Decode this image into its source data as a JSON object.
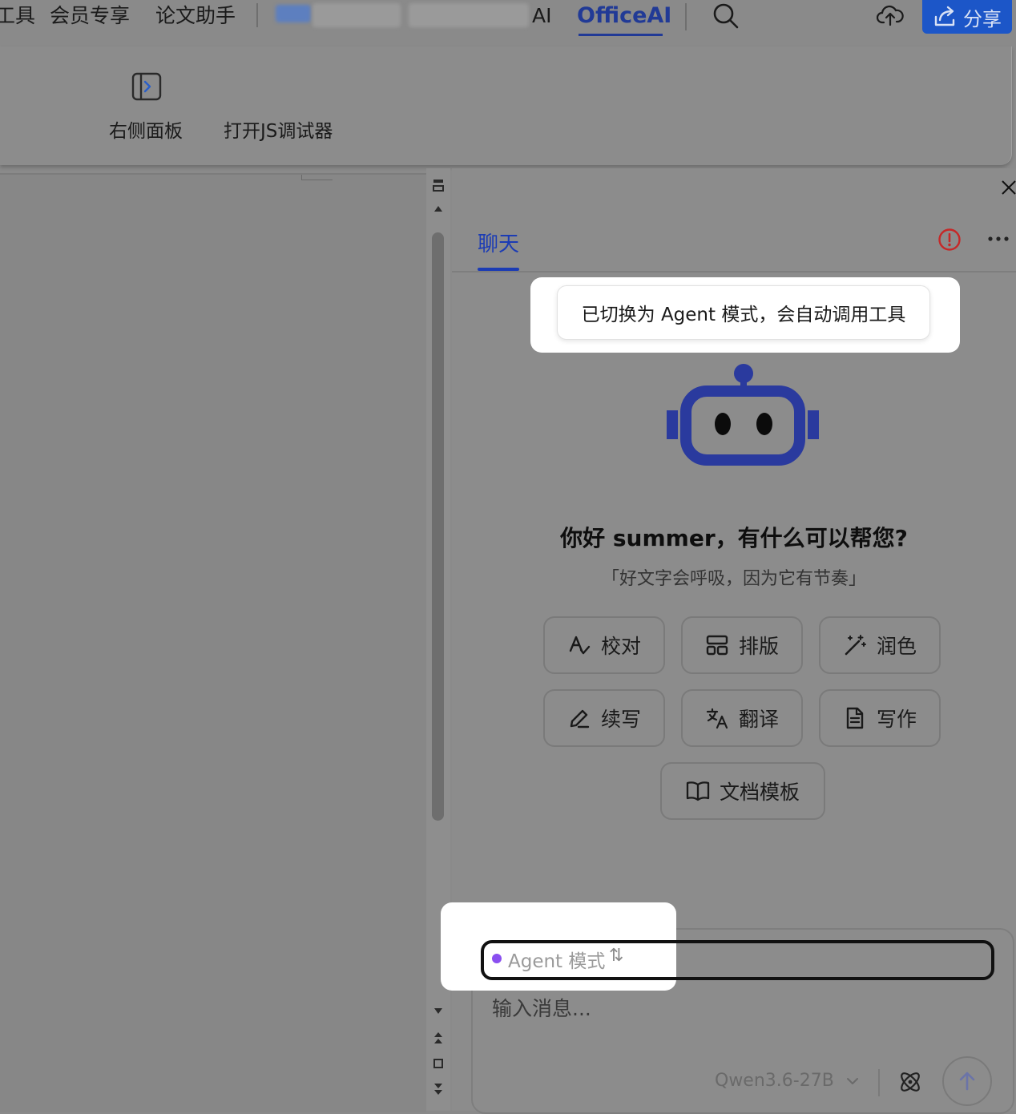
{
  "menubar": {
    "items": [
      "工具",
      "会员专享",
      "论文助手"
    ],
    "active_tab": "OfficeAI",
    "partial_tab_suffix": "AI",
    "share_label": "分享"
  },
  "ribbon": {
    "right_panel_label": "右侧面板",
    "js_debugger_label": "打开JS调试器"
  },
  "panel": {
    "tabs": [
      "聊天"
    ],
    "toast": "已切换为 Agent 模式，会自动调用工具",
    "greeting": "你好 summer，有什么可以帮您?",
    "slogan": "「好文字会呼吸，因为它有节奏」",
    "quick_actions": [
      {
        "label": "校对",
        "icon": "proofread-icon"
      },
      {
        "label": "排版",
        "icon": "layout-icon"
      },
      {
        "label": "润色",
        "icon": "magic-wand-icon"
      },
      {
        "label": "续写",
        "icon": "pencil-icon"
      },
      {
        "label": "翻译",
        "icon": "translate-icon"
      },
      {
        "label": "写作",
        "icon": "document-icon"
      },
      {
        "label": "文档模板",
        "icon": "book-icon"
      }
    ],
    "input": {
      "mode_label": "Agent 模式",
      "mode_switch": "⇅",
      "placeholder": "输入消息...",
      "model": "Qwen3.6-27B"
    }
  },
  "colors": {
    "accent": "#1c3cb4",
    "share_button": "#1c56c8",
    "agent_dot": "#8a4ff0",
    "alert": "#c62828"
  }
}
